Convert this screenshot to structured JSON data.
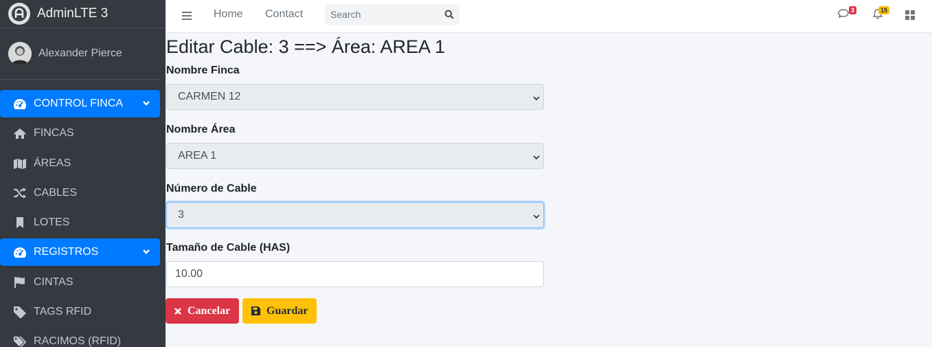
{
  "brand": {
    "name": "AdminLTE 3"
  },
  "user": {
    "name": "Alexander Pierce"
  },
  "sidebar": {
    "items": [
      {
        "label": "CONTROL FINCA",
        "icon": "tachometer-icon",
        "active": true,
        "chevron": true
      },
      {
        "label": "FINCAS",
        "icon": "home-icon",
        "active": false
      },
      {
        "label": "ÁREAS",
        "icon": "map-icon",
        "active": false
      },
      {
        "label": "CABLES",
        "icon": "random-icon",
        "active": false
      },
      {
        "label": "LOTES",
        "icon": "bookmark-icon",
        "active": false
      },
      {
        "label": "REGISTROS",
        "icon": "tachometer-icon",
        "active": true,
        "chevron": true
      },
      {
        "label": "CINTAS",
        "icon": "flag-icon",
        "active": false
      },
      {
        "label": "TAGS RFID",
        "icon": "tag-icon",
        "active": false
      },
      {
        "label": "RACIMOS (RFID)",
        "icon": "tags-icon",
        "active": false
      }
    ]
  },
  "navbar": {
    "home_label": "Home",
    "contact_label": "Contact",
    "search_placeholder": "Search",
    "messages_count": "3",
    "notifications_count": "15"
  },
  "page": {
    "title": "Editar Cable: 3 ==> Área: AREA 1"
  },
  "form": {
    "finca": {
      "label": "Nombre Finca",
      "value": "CARMEN 12"
    },
    "area": {
      "label": "Nombre Área",
      "value": "AREA 1"
    },
    "cable": {
      "label": "Número de Cable",
      "value": "3"
    },
    "size": {
      "label": "Tamaño de Cable (HAS)",
      "value": "10.00"
    },
    "cancel_label": "Cancelar",
    "save_label": "Guardar"
  },
  "colors": {
    "sidebar_bg": "#343a40",
    "primary": "#007bff",
    "danger": "#dc3545",
    "warning": "#ffc107"
  }
}
